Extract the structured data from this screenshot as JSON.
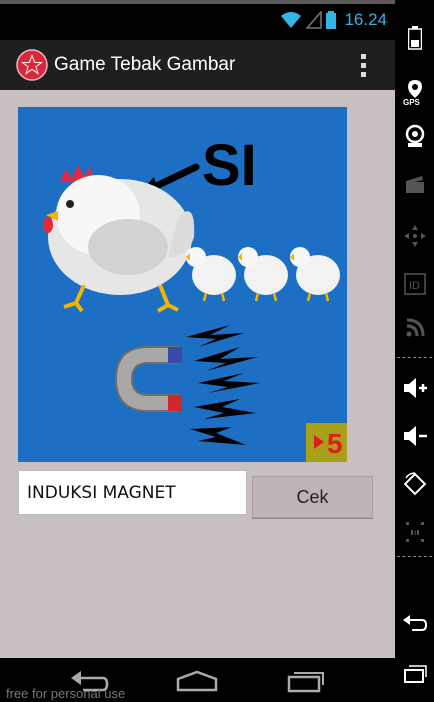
{
  "status": {
    "time": "16.24",
    "time_color": "#33b5e5"
  },
  "app": {
    "title": "Game Tebak Gambar",
    "actionbar_color": "#1f1f1f",
    "icon": "star-logo-icon"
  },
  "puzzle": {
    "word_label": "SI",
    "counter_value": "5",
    "background": "#1d6fc4",
    "icons": [
      "hen-icon",
      "chick-icon",
      "arrow-icon",
      "magnet-icon",
      "lightning-icon"
    ]
  },
  "form": {
    "answer_value": "INDUKSI MAGNET",
    "submit_label": "Cek"
  },
  "navigation": {
    "buttons": [
      "back-icon",
      "home-icon",
      "recent-apps-icon"
    ]
  },
  "emulator_panel": {
    "gps_label": "GPS",
    "id_label": "ID",
    "buttons": [
      "battery-icon",
      "gps-icon",
      "webcam-icon",
      "video-icon",
      "dpad-icon",
      "id-icon",
      "network-icon",
      "volume-up-icon",
      "volume-down-icon",
      "rotate-icon",
      "scale-icon",
      "back-icon",
      "recent-apps-icon"
    ]
  },
  "footer": {
    "watermark": "free for personal use"
  },
  "colors": {
    "content_background": "#c8c0c0",
    "accent": "#33b5e5"
  }
}
